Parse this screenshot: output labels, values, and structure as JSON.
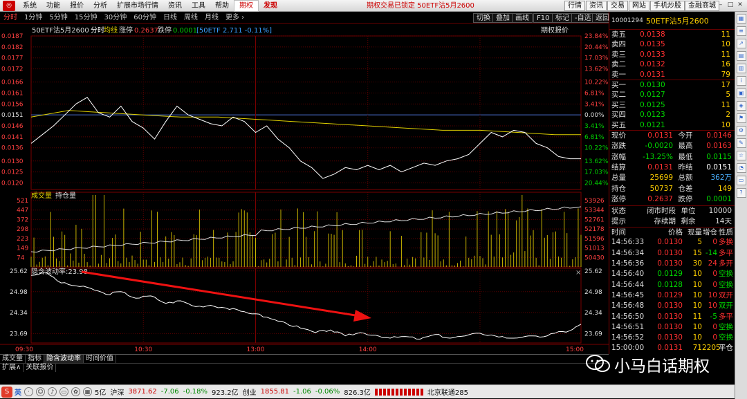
{
  "menubar": {
    "items": [
      "系统",
      "功能",
      "报价",
      "分析",
      "扩展市场行情",
      "资讯",
      "工具",
      "帮助"
    ],
    "options_label": "期权",
    "discover_label": "发现",
    "notice": "期权交易已锁定   50ETF沽5月2600",
    "right_buttons": [
      "行情",
      "资讯",
      "交易",
      "网站",
      "手机炒股",
      "金融商城"
    ]
  },
  "toolbar": {
    "tabs": [
      "分时",
      "1分钟",
      "5分钟",
      "15分钟",
      "30分钟",
      "60分钟",
      "日线",
      "周线",
      "月线",
      "更多 ›"
    ],
    "buttons": [
      "切换",
      "叠加",
      "画线",
      "F10",
      "标记",
      "-自选",
      "返回"
    ],
    "options_quote_label": "期权报价"
  },
  "chart_header": {
    "name": "50ETF沽5月2600",
    "mode": "分时",
    "avg_label": "均线",
    "limit_up_label": "涨停",
    "limit_up_value": "0.2637",
    "limit_down_label": "跌停",
    "limit_down_value": "0.0001",
    "underlying": "[50ETF 2.711 -0.11%]"
  },
  "volume_header": {
    "volume_label": "成交量",
    "oi_label": "持仓量"
  },
  "iv_header": {
    "label": "隐含波动率:23.98"
  },
  "chart_data": [
    {
      "type": "line",
      "title": "50ETF沽5月2600 分时",
      "y_left_ticks": [
        "0.0187",
        "0.0182",
        "0.0177",
        "0.0172",
        "0.0166",
        "0.0161",
        "0.0156",
        "0.0151",
        "0.0146",
        "0.0141",
        "0.0136",
        "0.0130",
        "0.0125",
        "0.0120"
      ],
      "y_right_ticks": [
        "23.84%",
        "20.44%",
        "17.03%",
        "13.62%",
        "10.22%",
        "6.81%",
        "3.41%",
        "0.00%",
        "3.41%",
        "6.81%",
        "10.22%",
        "13.62%",
        "17.03%",
        "20.44%"
      ],
      "ylim": [
        0.0117,
        0.0187
      ],
      "prev_settle": 0.0151,
      "x_ticks": [
        "09:30",
        "10:30",
        "13:00",
        "14:00",
        "15:00"
      ],
      "series": [
        {
          "name": "价格",
          "color": "#ffffff",
          "points": [
            [
              0,
              0.0138
            ],
            [
              6,
              0.0142
            ],
            [
              12,
              0.0146
            ],
            [
              18,
              0.0151
            ],
            [
              24,
              0.0156
            ],
            [
              30,
              0.0159
            ],
            [
              36,
              0.0152
            ],
            [
              42,
              0.015
            ],
            [
              48,
              0.0155
            ],
            [
              54,
              0.0148
            ],
            [
              60,
              0.0145
            ],
            [
              66,
              0.014
            ],
            [
              72,
              0.0148
            ],
            [
              78,
              0.0155
            ],
            [
              84,
              0.0151
            ],
            [
              90,
              0.0149
            ],
            [
              96,
              0.0147
            ],
            [
              102,
              0.0146
            ],
            [
              108,
              0.015
            ],
            [
              114,
              0.0148
            ],
            [
              120,
              0.0143
            ],
            [
              126,
              0.0146
            ],
            [
              132,
              0.014
            ],
            [
              138,
              0.0136
            ],
            [
              144,
              0.013
            ],
            [
              150,
              0.0127
            ],
            [
              156,
              0.0122
            ],
            [
              162,
              0.0124
            ],
            [
              168,
              0.0127
            ],
            [
              174,
              0.0126
            ],
            [
              180,
              0.0128
            ],
            [
              186,
              0.0126
            ],
            [
              192,
              0.0128
            ],
            [
              198,
              0.0125
            ],
            [
              204,
              0.0127
            ],
            [
              210,
              0.0129
            ],
            [
              216,
              0.0128
            ],
            [
              222,
              0.013
            ],
            [
              228,
              0.0131
            ],
            [
              234,
              0.0133
            ],
            [
              240,
              0.0138
            ],
            [
              246,
              0.0143
            ],
            [
              252,
              0.0141
            ],
            [
              258,
              0.0144
            ],
            [
              264,
              0.0143
            ],
            [
              270,
              0.0138
            ],
            [
              276,
              0.0136
            ],
            [
              282,
              0.0132
            ],
            [
              288,
              0.0131
            ],
            [
              294,
              0.0131
            ]
          ]
        },
        {
          "name": "均线",
          "color": "#e0d000",
          "points": [
            [
              0,
              0.015
            ],
            [
              20,
              0.0153
            ],
            [
              40,
              0.0152
            ],
            [
              60,
              0.0151
            ],
            [
              80,
              0.015
            ],
            [
              100,
              0.015
            ],
            [
              120,
              0.0149
            ],
            [
              140,
              0.0148
            ],
            [
              160,
              0.0147
            ],
            [
              180,
              0.0146
            ],
            [
              200,
              0.0145
            ],
            [
              220,
              0.0144
            ],
            [
              240,
              0.0144
            ],
            [
              260,
              0.0143
            ],
            [
              280,
              0.0142
            ],
            [
              294,
              0.0142
            ]
          ]
        }
      ]
    },
    {
      "type": "bar",
      "title": "成交量 / 持仓量",
      "y_left_ticks": [
        "521",
        "447",
        "372",
        "298",
        "223",
        "149",
        "74"
      ],
      "y_right_ticks": [
        "53926",
        "53344",
        "52761",
        "52178",
        "51596",
        "51013",
        "50430"
      ],
      "volume_max": 521,
      "oi_range": [
        50140,
        53926
      ]
    },
    {
      "type": "line",
      "title": "隐含波动率",
      "y_ticks": [
        "25.62",
        "24.98",
        "24.34",
        "23.69"
      ],
      "ylim": [
        23.4,
        25.7
      ],
      "series": [
        {
          "name": "隐含波动率",
          "color": "#ffffff",
          "points": [
            [
              0,
              25.48
            ],
            [
              8,
              25.58
            ],
            [
              16,
              25.25
            ],
            [
              24,
              25.16
            ],
            [
              32,
              25.08
            ],
            [
              40,
              24.9
            ],
            [
              48,
              24.98
            ],
            [
              56,
              24.78
            ],
            [
              64,
              24.85
            ],
            [
              72,
              24.62
            ],
            [
              80,
              24.7
            ],
            [
              88,
              24.52
            ],
            [
              96,
              24.56
            ],
            [
              104,
              24.48
            ],
            [
              112,
              24.38
            ],
            [
              120,
              24.3
            ],
            [
              128,
              24.15
            ],
            [
              136,
              24.02
            ],
            [
              144,
              23.86
            ],
            [
              152,
              23.72
            ],
            [
              160,
              23.8
            ],
            [
              168,
              23.62
            ],
            [
              176,
              23.72
            ],
            [
              184,
              23.64
            ],
            [
              192,
              23.55
            ],
            [
              200,
              23.6
            ],
            [
              208,
              23.52
            ],
            [
              216,
              23.66
            ],
            [
              224,
              23.55
            ],
            [
              232,
              23.62
            ],
            [
              240,
              23.7
            ],
            [
              248,
              23.62
            ],
            [
              256,
              23.55
            ],
            [
              264,
              23.6
            ],
            [
              272,
              23.58
            ],
            [
              280,
              23.7
            ],
            [
              288,
              23.78
            ],
            [
              294,
              23.98
            ]
          ]
        }
      ]
    }
  ],
  "right_panel": {
    "code": "10001294",
    "name": "50ETF沽5月2600",
    "asks": [
      {
        "label": "卖五",
        "price": "0.0138",
        "vol": "11"
      },
      {
        "label": "卖四",
        "price": "0.0135",
        "vol": "10"
      },
      {
        "label": "卖三",
        "price": "0.0133",
        "vol": "11"
      },
      {
        "label": "卖二",
        "price": "0.0132",
        "vol": "16"
      },
      {
        "label": "卖一",
        "price": "0.0131",
        "vol": "79"
      }
    ],
    "bids": [
      {
        "label": "买一",
        "price": "0.0130",
        "vol": "17"
      },
      {
        "label": "买二",
        "price": "0.0127",
        "vol": "5"
      },
      {
        "label": "买三",
        "price": "0.0125",
        "vol": "11"
      },
      {
        "label": "买四",
        "price": "0.0123",
        "vol": "2"
      },
      {
        "label": "买五",
        "price": "0.0121",
        "vol": "10"
      }
    ],
    "quote": [
      {
        "k": "现价",
        "v": "0.0131",
        "vc": "c-red",
        "k2": "今开",
        "v2": "0.0146",
        "v2c": "c-red"
      },
      {
        "k": "涨跌",
        "v": "-0.0020",
        "vc": "c-grn",
        "k2": "最高",
        "v2": "0.0163",
        "v2c": "c-red"
      },
      {
        "k": "涨幅",
        "v": "-13.25%",
        "vc": "c-grn",
        "k2": "最低",
        "v2": "0.0115",
        "v2c": "c-grn"
      },
      {
        "k": "结算",
        "v": "0.0131",
        "vc": "c-red",
        "k2": "昨结",
        "v2": "0.0151",
        "v2c": "c-wht"
      },
      {
        "k": "总量",
        "v": "25699",
        "vc": "c-yel",
        "k2": "总额",
        "v2": "362万",
        "v2c": "c-blu"
      },
      {
        "k": "持仓",
        "v": "50737",
        "vc": "c-yel",
        "k2": "仓差",
        "v2": "149",
        "v2c": "c-yel"
      },
      {
        "k": "涨停",
        "v": "0.2637",
        "vc": "c-red",
        "k2": "跌停",
        "v2": "0.0001",
        "v2c": "c-grn"
      }
    ],
    "status": {
      "k": "状态",
      "v": "闭市时段",
      "k2": "单位",
      "v2": "10000"
    },
    "hint": {
      "k": "提示",
      "v": "存续期",
      "k2": "剩余",
      "v2": "14天"
    },
    "trade_headers": [
      "时间",
      "价格",
      "现量",
      "增仓",
      "性质"
    ],
    "trades": [
      {
        "t": "14:56:33",
        "p": "0.0130",
        "pc": "c-red",
        "q": "5",
        "d": "0",
        "dc": "c-red",
        "n": "多换",
        "nc": "c-red"
      },
      {
        "t": "14:56:34",
        "p": "0.0130",
        "pc": "c-red",
        "q": "15",
        "d": "-14",
        "dc": "c-grn",
        "n": "多平",
        "nc": "c-red"
      },
      {
        "t": "14:56:36",
        "p": "0.0130",
        "pc": "c-red",
        "q": "30",
        "d": "24",
        "dc": "c-red",
        "n": "多开",
        "nc": "c-red"
      },
      {
        "t": "14:56:40",
        "p": "0.0129",
        "pc": "c-grn",
        "q": "10",
        "d": "0",
        "dc": "c-red",
        "n": "空换",
        "nc": "c-grn"
      },
      {
        "t": "14:56:44",
        "p": "0.0128",
        "pc": "c-grn",
        "q": "10",
        "d": "0",
        "dc": "c-red",
        "n": "空换",
        "nc": "c-grn"
      },
      {
        "t": "14:56:45",
        "p": "0.0129",
        "pc": "c-red",
        "q": "10",
        "d": "10",
        "dc": "c-red",
        "n": "双开",
        "nc": "c-red"
      },
      {
        "t": "14:56:48",
        "p": "0.0130",
        "pc": "c-red",
        "q": "10",
        "d": "10",
        "dc": "c-red",
        "n": "双开",
        "nc": "c-grn"
      },
      {
        "t": "14:56:50",
        "p": "0.0130",
        "pc": "c-red",
        "q": "11",
        "d": "-5",
        "dc": "c-grn",
        "n": "多平",
        "nc": "c-red"
      },
      {
        "t": "14:56:51",
        "p": "0.0130",
        "pc": "c-red",
        "q": "10",
        "d": "0",
        "dc": "c-red",
        "n": "空换",
        "nc": "c-grn"
      },
      {
        "t": "14:56:52",
        "p": "0.0130",
        "pc": "c-red",
        "q": "10",
        "d": "0",
        "dc": "c-red",
        "n": "空换",
        "nc": "c-grn"
      },
      {
        "t": "15:00:00",
        "p": "0.0131",
        "pc": "c-red",
        "q": "71",
        "d": "2205",
        "dc": "c-yel",
        "n": "平仓",
        "nc": "c-wht"
      }
    ]
  },
  "bottom_tabs": [
    "成交量",
    "指标",
    "隐含波动率",
    "时间价值"
  ],
  "bottom_tabs2": [
    "扩展∧",
    "关联报价"
  ],
  "statusbar": {
    "ime_label": "英",
    "items": [
      {
        "text": "5亿",
        "c": ""
      },
      {
        "text": "沪深",
        "c": ""
      },
      {
        "text": "3871.62",
        "c": "#c00"
      },
      {
        "text": "-7.06",
        "c": "#080"
      },
      {
        "text": "-0.18%",
        "c": "#080"
      },
      {
        "text": "923.2亿",
        "c": ""
      },
      {
        "text": "创业",
        "c": ""
      },
      {
        "text": "1855.81",
        "c": "#c00"
      },
      {
        "text": "-1.06",
        "c": "#080"
      },
      {
        "text": "-0.06%",
        "c": "#080"
      },
      {
        "text": "826.3亿",
        "c": ""
      },
      {
        "text": "北京联通285",
        "c": ""
      }
    ]
  },
  "watermark": "小马白话期权"
}
